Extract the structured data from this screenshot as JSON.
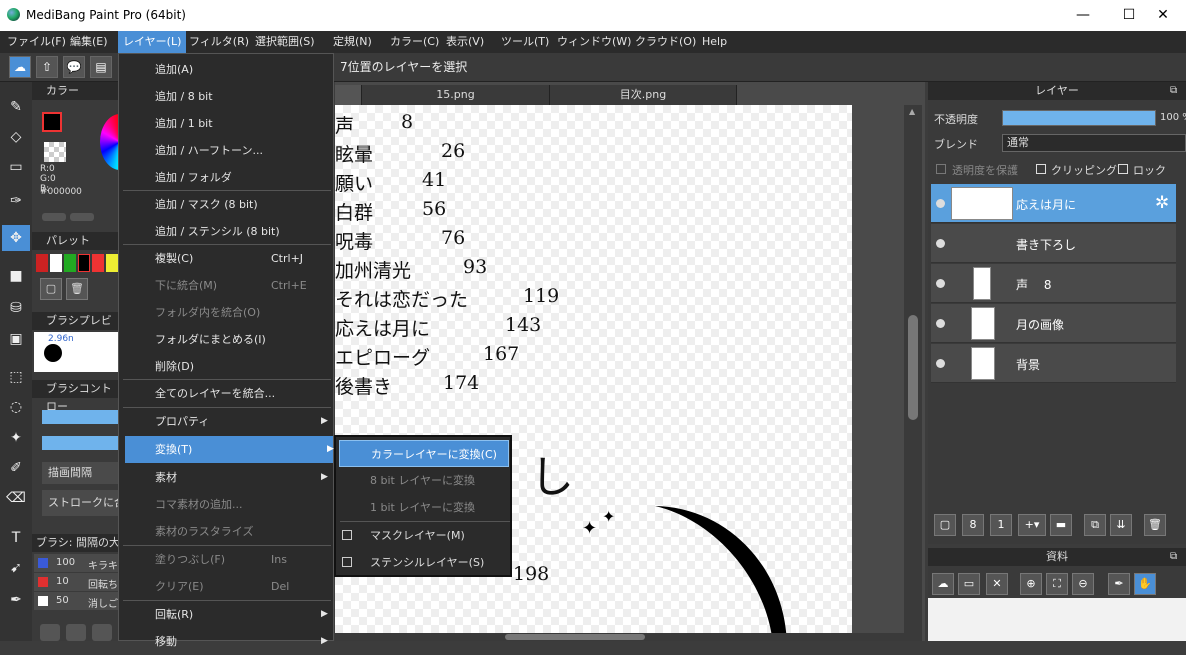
{
  "window": {
    "title": "MediBang Paint Pro (64bit)",
    "minimize": "—",
    "maximize": "☐",
    "close": "✕"
  },
  "menubar": [
    "ファイル(F)",
    "編集(E)",
    "レイヤー(L)",
    "フィルタ(R)",
    "選択範囲(S)",
    "定規(N)",
    "カラー(C)",
    "表示(V)",
    "ツール(T)",
    "ウィンドウ(W)",
    "クラウド(O)",
    "Help"
  ],
  "status_text": "7位置のレイヤーを選択",
  "tabs": [
    "15.png",
    "目次.png"
  ],
  "color_panel": {
    "title": "カラー",
    "r": "R:0",
    "g": "G:0",
    "b": "B:",
    "hex": "#000000",
    "palette_title": "パレット",
    "brush_preview_title": "ブラシプレビュー",
    "brush_size": "2.96n",
    "brush_control_title": "ブラシコントロー",
    "interval_label": "描画間隔",
    "stroke_label": "ストロークに合",
    "brush_list_title": "ブラシ: 間隔の大",
    "brush_items": [
      {
        "size": "100",
        "name": "キラキ",
        "color": "#3a5ad8"
      },
      {
        "size": "10",
        "name": "回転ち",
        "color": "#e03030"
      },
      {
        "size": "50",
        "name": "消しご",
        "color": "#ffffff"
      }
    ]
  },
  "toc": [
    {
      "title": "声",
      "page": "8"
    },
    {
      "title": "眩暈",
      "page": "26"
    },
    {
      "title": "願い",
      "page": "41"
    },
    {
      "title": "白群",
      "page": "56"
    },
    {
      "title": "呪毒",
      "page": "76"
    },
    {
      "title": "加州清光",
      "page": "93"
    },
    {
      "title": "それは恋だった",
      "page": "119"
    },
    {
      "title": "応えは月に",
      "page": "143"
    },
    {
      "title": "エピローグ",
      "page": "167"
    },
    {
      "title": "後書き",
      "page": "174"
    }
  ],
  "canvas_extra": {
    "partial_char": "し",
    "partial_number": "198",
    "sparkle": "✦"
  },
  "layer_menu": {
    "items": [
      {
        "label": "追加(A)"
      },
      {
        "label": "追加 / 8 bit"
      },
      {
        "label": "追加 / 1 bit"
      },
      {
        "label": "追加 / ハーフトーン..."
      },
      {
        "label": "追加 / フォルダ"
      },
      {
        "label": "追加 / マスク (8 bit)"
      },
      {
        "label": "追加 / ステンシル (8 bit)"
      },
      {
        "label": "複製(C)",
        "shortcut": "Ctrl+J"
      },
      {
        "label": "下に統合(M)",
        "shortcut": "Ctrl+E",
        "disabled": true
      },
      {
        "label": "フォルダ内を統合(O)",
        "disabled": true
      },
      {
        "label": "フォルダにまとめる(I)"
      },
      {
        "label": "削除(D)"
      },
      {
        "label": "全てのレイヤーを統合..."
      },
      {
        "label": "プロパティ",
        "arrow": "▶"
      },
      {
        "label": "変換(T)",
        "arrow": "▶",
        "highlight": true
      },
      {
        "label": "素材",
        "arrow": "▶"
      },
      {
        "label": "コマ素材の追加...",
        "disabled": true
      },
      {
        "label": "素材のラスタライズ",
        "disabled": true
      },
      {
        "label": "塗りつぶし(F)",
        "shortcut": "Ins",
        "disabled": true
      },
      {
        "label": "クリア(E)",
        "shortcut": "Del",
        "disabled": true
      },
      {
        "label": "回転(R)",
        "arrow": "▶"
      },
      {
        "label": "移動",
        "arrow": "▶"
      }
    ]
  },
  "convert_submenu": [
    "カラーレイヤーに変換(C)",
    "8 bit レイヤーに変換",
    "1 bit レイヤーに変換",
    "マスクレイヤー(M)",
    "ステンシルレイヤー(S)"
  ],
  "layer_panel": {
    "title": "レイヤー",
    "opacity_label": "不透明度",
    "opacity_value": "100 %",
    "opacity": 1.0,
    "blend_label": "ブレンド",
    "blend_value": "通常",
    "protect_label": "透明度を保護",
    "clipping_label": "クリッピング",
    "lock_label": "ロック",
    "layers": [
      "応えは月に",
      "書き下ろし",
      "声　 8",
      "月の画像",
      "背景"
    ]
  },
  "material_panel": {
    "title": "資料"
  }
}
